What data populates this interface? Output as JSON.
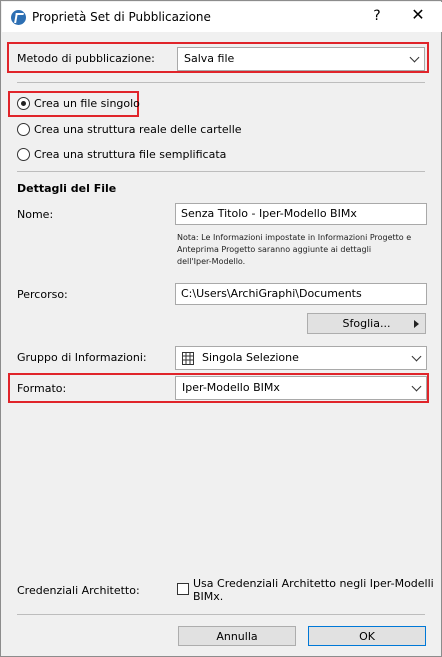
{
  "window": {
    "title": "Proprietà Set di Pubblicazione",
    "help": "?",
    "close": "✕"
  },
  "method": {
    "label": "Metodo di pubblicazione:",
    "value": "Salva file"
  },
  "options": [
    {
      "label": "Crea un file singolo",
      "selected": true
    },
    {
      "label": "Crea una struttura reale delle cartelle",
      "selected": false
    },
    {
      "label": "Crea una struttura file semplificata",
      "selected": false
    }
  ],
  "details": {
    "heading": "Dettagli del File",
    "name_label": "Nome:",
    "name_value": "Senza Titolo - Iper-Modello BIMx",
    "note_line1": "Nota: Le Informazioni impostate in Informazioni Progetto e",
    "note_line2": "Anteprima Progetto saranno aggiunte ai dettagli",
    "note_line3": "dell'Iper-Modello.",
    "path_label": "Percorso:",
    "path_value": "C:\\Users\\ArchiGraphi\\Documents",
    "browse_label": "Sfoglia...",
    "group_label": "Gruppo di Informazioni:",
    "group_value": "Singola Selezione",
    "format_label": "Formato:",
    "format_value": "Iper-Modello BIMx"
  },
  "credentials": {
    "label": "Credenziali Architetto:",
    "checkbox_line1": "Usa Credenziali Architetto negli Iper-Modelli",
    "checkbox_line2": "BIMx.",
    "checked": false
  },
  "footer": {
    "cancel": "Annulla",
    "ok": "OK"
  },
  "colors": {
    "highlight": "#e0242a",
    "accent": "#0078d7"
  }
}
